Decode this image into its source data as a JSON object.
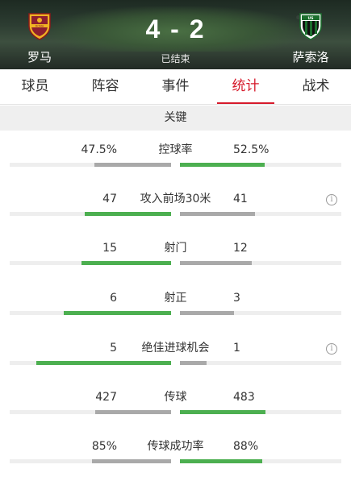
{
  "match": {
    "home_team": "罗马",
    "away_team": "萨索洛",
    "score": "4 - 2",
    "status": "已结束",
    "home_crest_icon": "as-roma-crest-icon",
    "away_crest_icon": "sassuolo-crest-icon"
  },
  "tabs": [
    {
      "label": "球员",
      "active": false
    },
    {
      "label": "阵容",
      "active": false
    },
    {
      "label": "事件",
      "active": false
    },
    {
      "label": "统计",
      "active": true
    },
    {
      "label": "战术",
      "active": false
    }
  ],
  "section": {
    "title": "关键"
  },
  "colors": {
    "accent": "#d61a2b",
    "leader_bar": "#4caf50",
    "trailer_bar": "#a9a9a9",
    "track": "#eeeeee"
  },
  "stats": [
    {
      "name": "控球率",
      "home": "47.5%",
      "away": "52.5%",
      "home_share": 0.475,
      "away_share": 0.525,
      "leader": "away",
      "info": false
    },
    {
      "name": "攻入前场30米",
      "home": "47",
      "away": "41",
      "home_share": 0.534,
      "away_share": 0.466,
      "leader": "home",
      "info": true
    },
    {
      "name": "射门",
      "home": "15",
      "away": "12",
      "home_share": 0.556,
      "away_share": 0.444,
      "leader": "home",
      "info": false
    },
    {
      "name": "射正",
      "home": "6",
      "away": "3",
      "home_share": 0.667,
      "away_share": 0.333,
      "leader": "home",
      "info": false
    },
    {
      "name": "绝佳进球机会",
      "home": "5",
      "away": "1",
      "home_share": 0.833,
      "away_share": 0.167,
      "leader": "home",
      "info": true
    },
    {
      "name": "传球",
      "home": "427",
      "away": "483",
      "home_share": 0.469,
      "away_share": 0.531,
      "leader": "away",
      "info": false
    },
    {
      "name": "传球成功率",
      "home": "85%",
      "away": "88%",
      "home_share": 0.491,
      "away_share": 0.509,
      "leader": "away",
      "info": false
    }
  ]
}
